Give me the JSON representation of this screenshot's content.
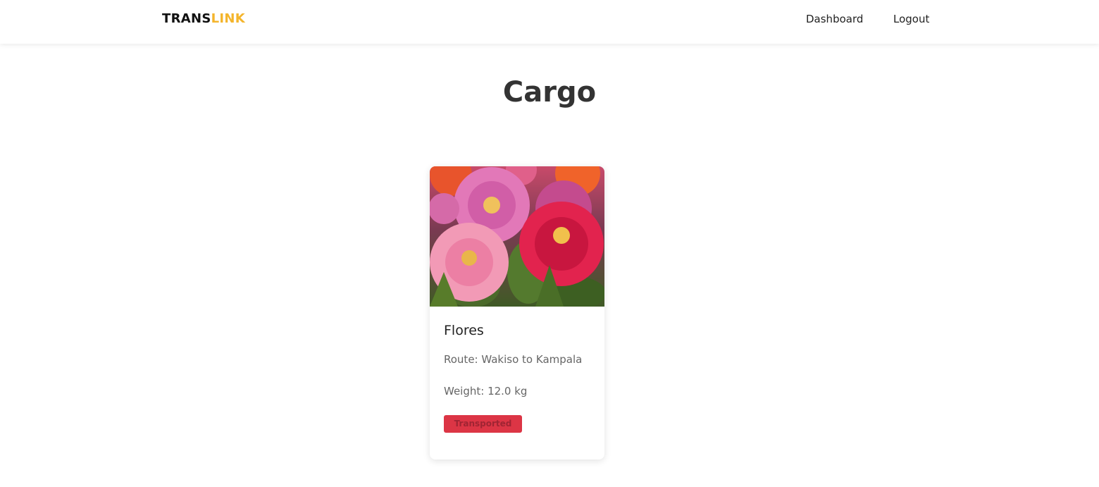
{
  "navbar": {
    "brand_part1": "TRANS",
    "brand_part2": "LINK",
    "links": {
      "dashboard": "Dashboard",
      "logout": "Logout"
    }
  },
  "page": {
    "title": "Cargo"
  },
  "cargo_cards": [
    {
      "name": "Flores",
      "route": "Route: Wakiso to Kampala",
      "weight": "Weight: 12.0 kg",
      "status": "Transported",
      "image_icon": "flowers-photo"
    }
  ],
  "colors": {
    "brand_accent": "#f4b52c",
    "status_badge": "#dc3545"
  }
}
